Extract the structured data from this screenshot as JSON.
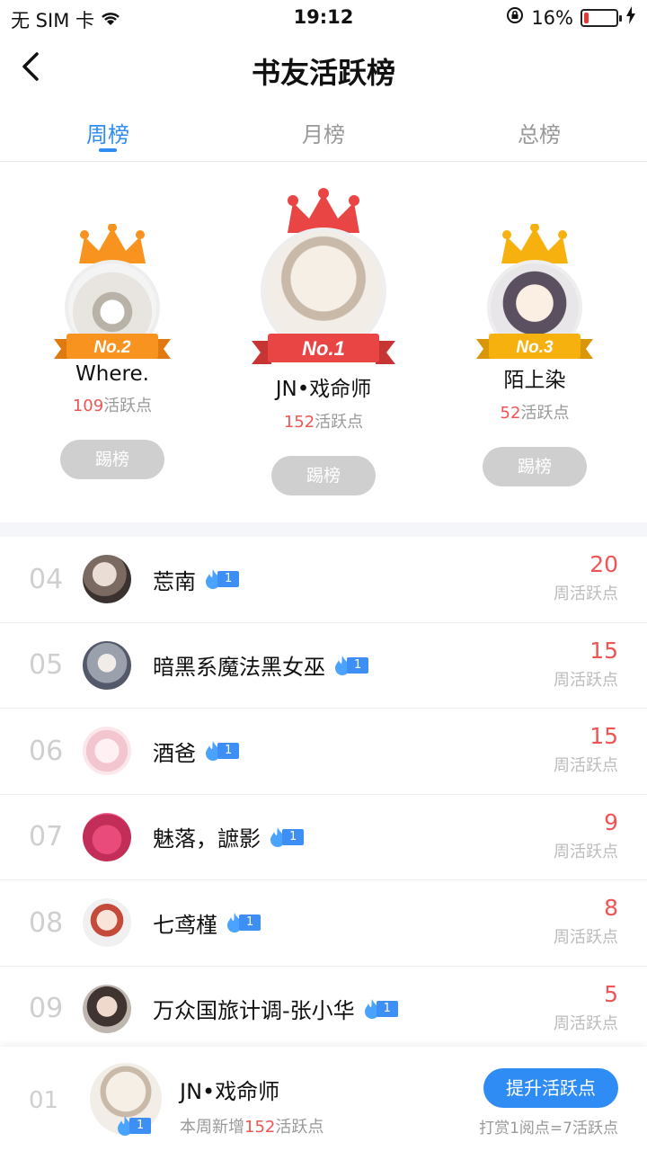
{
  "status_bar": {
    "carrier": "无 SIM 卡",
    "time": "19:12",
    "battery": "16%",
    "battery_level": 0.16
  },
  "nav": {
    "title": "书友活跃榜"
  },
  "tabs": [
    {
      "label": "周榜",
      "active": true
    },
    {
      "label": "月榜",
      "active": false
    },
    {
      "label": "总榜",
      "active": false
    }
  ],
  "podium": {
    "first": {
      "rank_label": "No.1",
      "name": "JN•戏命师",
      "points": "152",
      "points_suffix": "活跃点",
      "button": "踢榜",
      "crown_color": "#e94545"
    },
    "second": {
      "rank_label": "No.2",
      "name": "Where.",
      "points": "109",
      "points_suffix": "活跃点",
      "button": "踢榜",
      "crown_color": "#f7931e"
    },
    "third": {
      "rank_label": "No.3",
      "name": "陌上染",
      "points": "52",
      "points_suffix": "活跃点",
      "button": "踢榜",
      "crown_color": "#f6b10f"
    }
  },
  "list": [
    {
      "rank": "04",
      "name": "莣南",
      "level": "1",
      "score": "20",
      "score_label": "周活跃点"
    },
    {
      "rank": "05",
      "name": "暗黑系魔法黑女巫",
      "level": "1",
      "score": "15",
      "score_label": "周活跃点"
    },
    {
      "rank": "06",
      "name": "酒爸",
      "level": "1",
      "score": "15",
      "score_label": "周活跃点"
    },
    {
      "rank": "07",
      "name": "魅落，謶影",
      "level": "1",
      "score": "9",
      "score_label": "周活跃点"
    },
    {
      "rank": "08",
      "name": "七鸢槿",
      "level": "1",
      "score": "8",
      "score_label": "周活跃点"
    },
    {
      "rank": "09",
      "name": "万众国旅计调-张小华",
      "level": "1",
      "score": "5",
      "score_label": "周活跃点"
    }
  ],
  "me": {
    "rank": "01",
    "name": "JN•戏命师",
    "level": "1",
    "sub_prefix": "本周新增",
    "sub_points": "152",
    "sub_suffix": "活跃点",
    "button": "提升活跃点",
    "note": "打赏1阅点=7活跃点"
  }
}
